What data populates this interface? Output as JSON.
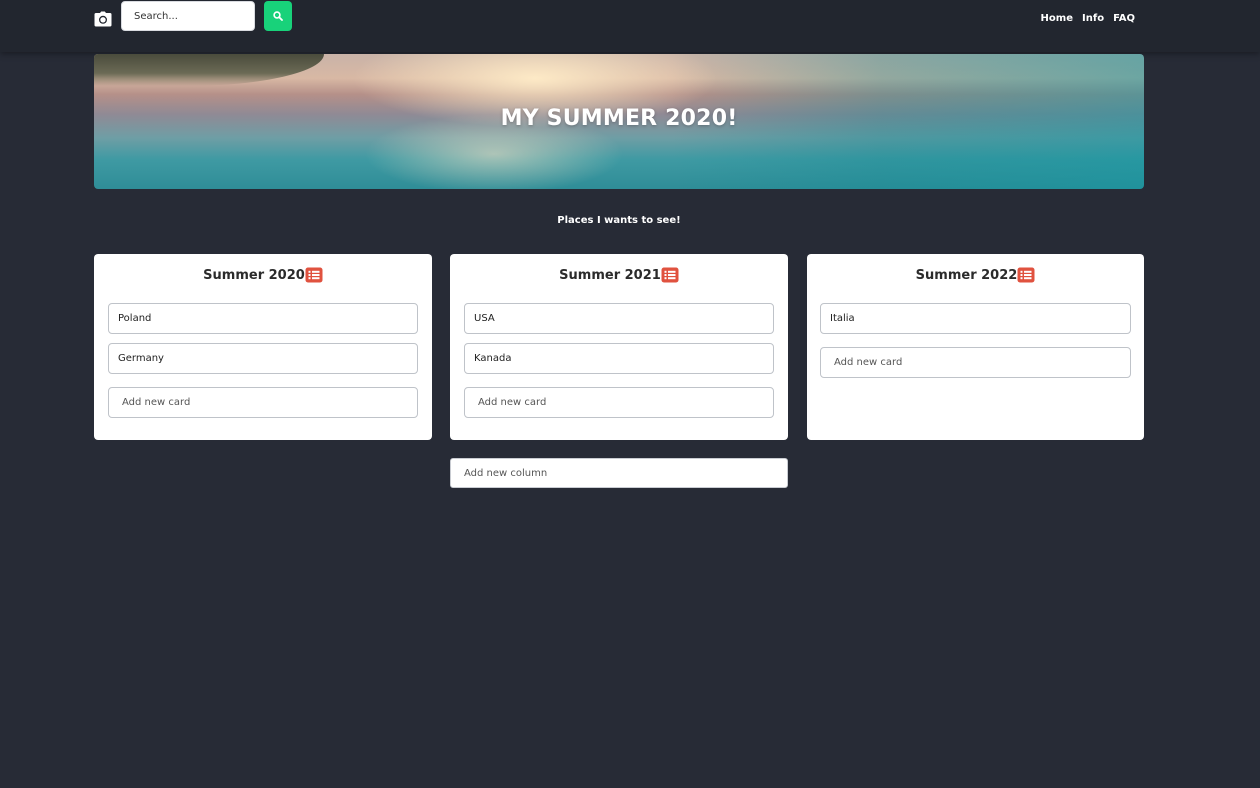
{
  "nav": {
    "search_placeholder": "Search...",
    "links": [
      "Home",
      "Info",
      "FAQ"
    ]
  },
  "hero": {
    "title": "MY SUMMER 2020!"
  },
  "subtitle": "Places I wants to see!",
  "columns": [
    {
      "title": "Summer 2020",
      "cards": [
        "Poland",
        "Germany"
      ],
      "add_card_placeholder": "Add new card"
    },
    {
      "title": "Summer 2021",
      "cards": [
        "USA",
        "Kanada"
      ],
      "add_card_placeholder": "Add new card"
    },
    {
      "title": "Summer 2022",
      "cards": [
        "Italia"
      ],
      "add_card_placeholder": "Add new card"
    }
  ],
  "add_column_placeholder": "Add new column",
  "colors": {
    "background": "#272b36",
    "navbar": "#22262f",
    "search_button": "#18d27a",
    "list_icon": "#e0523f"
  },
  "icons": {
    "camera": "camera-icon",
    "search": "search-icon",
    "list": "list-icon"
  }
}
